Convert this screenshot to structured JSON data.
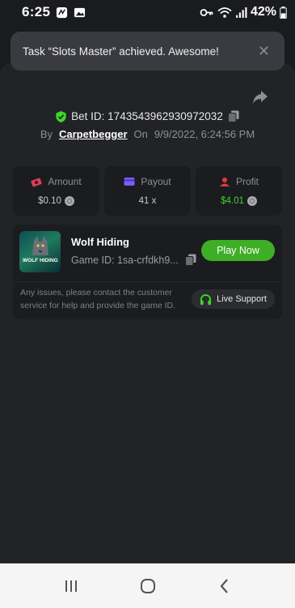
{
  "status_bar": {
    "time": "6:25",
    "battery": "42%"
  },
  "toast": {
    "message": "Task “Slots Master” achieved. Awesome!"
  },
  "bet": {
    "id_label": "Bet ID: 1743543962930972032",
    "by_label": "By",
    "username": "Carpetbegger",
    "on_label": "On",
    "datetime": "9/9/2022, 6:24:56 PM"
  },
  "stats": [
    {
      "label": "Amount",
      "value": "$0.10",
      "icon": "amount-icon",
      "color": "#e23b5a"
    },
    {
      "label": "Payout",
      "value": "41 x",
      "icon": "payout-icon",
      "color": "#7b5cff"
    },
    {
      "label": "Profit",
      "value": "$4.01",
      "icon": "profit-icon",
      "color": "#e23b3b"
    }
  ],
  "game": {
    "name": "Wolf Hiding",
    "id_label": "Game ID: 1sa-crfdkh9...",
    "thumb_text": "WOLF HIDING",
    "play_label": "Play Now",
    "support_text": "Any issues, please contact the customer service for help and provide the game ID.",
    "live_label": "Live Support"
  },
  "colors": {
    "accent_green": "#3dae25",
    "profit_green": "#3dd62a"
  }
}
